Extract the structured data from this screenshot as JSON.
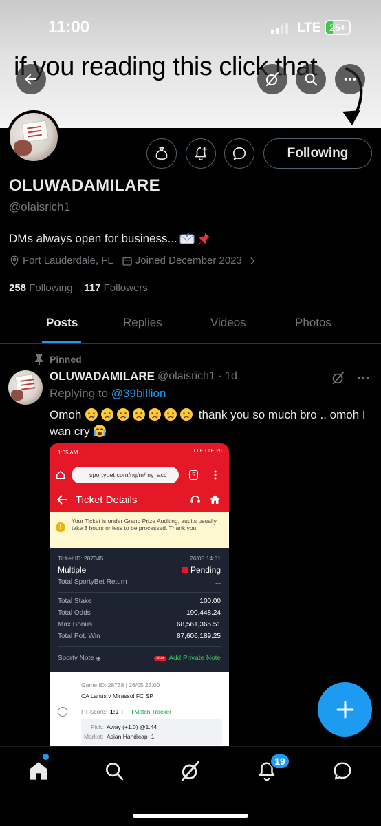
{
  "status_bar": {
    "time": "11:00",
    "network": "LTE",
    "battery": "25+"
  },
  "banner": {
    "text": "if you reading this click that"
  },
  "profile": {
    "name": "OLUWADAMILARE",
    "handle": "@olaisrich1",
    "bio": "DMs always open for business...",
    "bio_emojis": [
      "incoming-envelope",
      "pushpin"
    ],
    "location": "Fort Lauderdale, FL",
    "joined": "Joined December 2023",
    "following_count": "258",
    "following_label": "Following",
    "followers_count": "117",
    "followers_label": "Followers",
    "follow_button": "Following"
  },
  "tabs": [
    {
      "label": "Posts",
      "active": true
    },
    {
      "label": "Replies",
      "active": false
    },
    {
      "label": "Videos",
      "active": false
    },
    {
      "label": "Photos",
      "active": false
    }
  ],
  "post": {
    "pinned_label": "Pinned",
    "name": "OLUWADAMILARE",
    "handle_time": "@olaisrich1 · 1d",
    "replying_prefix": "Replying to",
    "replying_to": "@39billion",
    "text_start": "Omoh",
    "text_mid": "thank you so much bro .. omoh I wan cry",
    "emojis_crying": 7
  },
  "embedded_screenshot": {
    "time": "1:05 AM",
    "status_right": "LTE LTE 20",
    "url": "sportybet.com/ng/m/my_acc",
    "tab_count": "5",
    "title": "Ticket Details",
    "warning": "Your Ticket is under Grand Prize Auditing, audits usually take 3 hours or less to be processed. Thank you.",
    "ticket_id": "Ticket ID: 287345",
    "ticket_date": "26/05 14:51",
    "bet_type": "Multiple",
    "status": "Pending",
    "return_label": "Total SportyBet Return",
    "return_value": "--",
    "stake_label": "Total Stake",
    "stake": "100.00",
    "odds_label": "Total Odds",
    "odds": "190,448.24",
    "bonus_label": "Max Bonus",
    "bonus": "68,561,365.51",
    "win_label": "Total Pot. Win",
    "win": "87,606,189.25",
    "note_label": "Sporty Note",
    "new_badge": "New",
    "add_note": "Add Private Note",
    "game_id": "Game ID: 28738 | 26/05 23:00",
    "match": "CA Lanus v Mirassol FC SP",
    "ft_score_label": "FT Score:",
    "ft_score": "1:0",
    "match_tracker": "Match Tracker",
    "pick_label": "Pick:",
    "pick": "Away (+1.0) @1.44",
    "market_label": "Market:",
    "market": "Asian Handicap -1"
  },
  "bottom_nav": {
    "notifications_badge": "19"
  },
  "colors": {
    "accent": "#1d9bf0",
    "background": "#000000",
    "muted": "#71767b",
    "sportybet_red": "#e41827"
  }
}
